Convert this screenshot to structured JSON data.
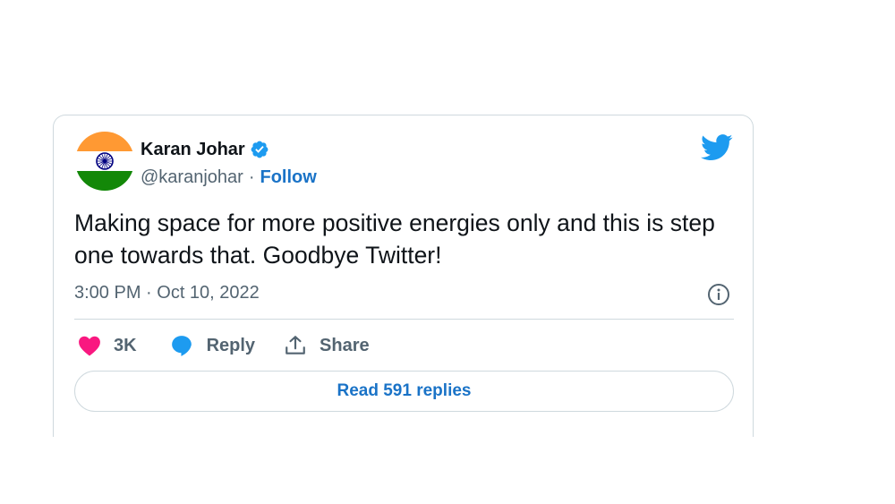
{
  "author": {
    "display_name": "Karan Johar",
    "handle": "@karanjohar",
    "separator": "·",
    "follow_label": "Follow",
    "verified": true,
    "avatar": "india-flag-avatar"
  },
  "tweet": {
    "text": "Making space for more positive energies only and this is step one towards that. Goodbye Twitter!",
    "timestamp": "3:00 PM · Oct 10, 2022"
  },
  "actions": {
    "like_count": "3K",
    "reply_label": "Reply",
    "share_label": "Share"
  },
  "read_replies_label": "Read 591 replies",
  "icons": {
    "brand": "twitter-bird-icon",
    "verified": "verified-badge-icon",
    "info": "info-icon",
    "like": "heart-icon",
    "reply": "speech-bubble-icon",
    "share": "share-arrow-icon"
  },
  "colors": {
    "accent": "#1d9bf0",
    "link": "#1a73c7",
    "heart": "#f91880",
    "text": "#0f1419",
    "muted": "#536471",
    "border": "#cfd9de",
    "flag_saffron": "#ff9933",
    "flag_green": "#138808",
    "flag_chakra": "#000080"
  }
}
